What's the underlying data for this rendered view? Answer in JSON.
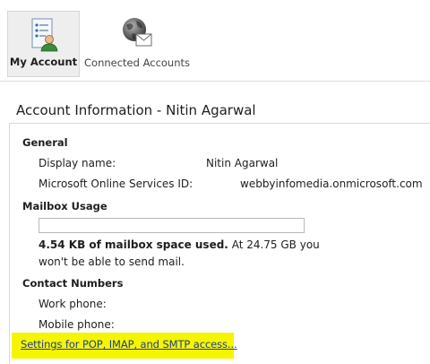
{
  "toolbar": {
    "my_account": {
      "label": "My Account",
      "icon": "account-form-icon"
    },
    "connected_accounts": {
      "label": "Connected Accounts",
      "icon": "globe-mail-icon"
    }
  },
  "account": {
    "title": "Account Information - Nitin Agarwal",
    "general": {
      "heading": "General",
      "display_name_label": "Display name:",
      "display_name_value": "Nitin Agarwal",
      "ms_id_label": "Microsoft Online Services ID:",
      "ms_id_value": "webbyinfomedia.onmicrosoft.com"
    },
    "mailbox": {
      "heading": "Mailbox Usage",
      "usage_fraction": 0.0,
      "used_bold": "4.54 KB of mailbox space used.",
      "used_rest": " At 24.75 GB you",
      "line2": "won't be able to send mail."
    },
    "contact": {
      "heading": "Contact Numbers",
      "work_label": "Work phone:",
      "mobile_label": "Mobile phone:"
    },
    "settings_link": "Settings for POP, IMAP, and SMTP access..."
  },
  "colors": {
    "highlight": "#f5f500",
    "link": "#1f3f8f",
    "selected_bg": "#eeeeee"
  }
}
